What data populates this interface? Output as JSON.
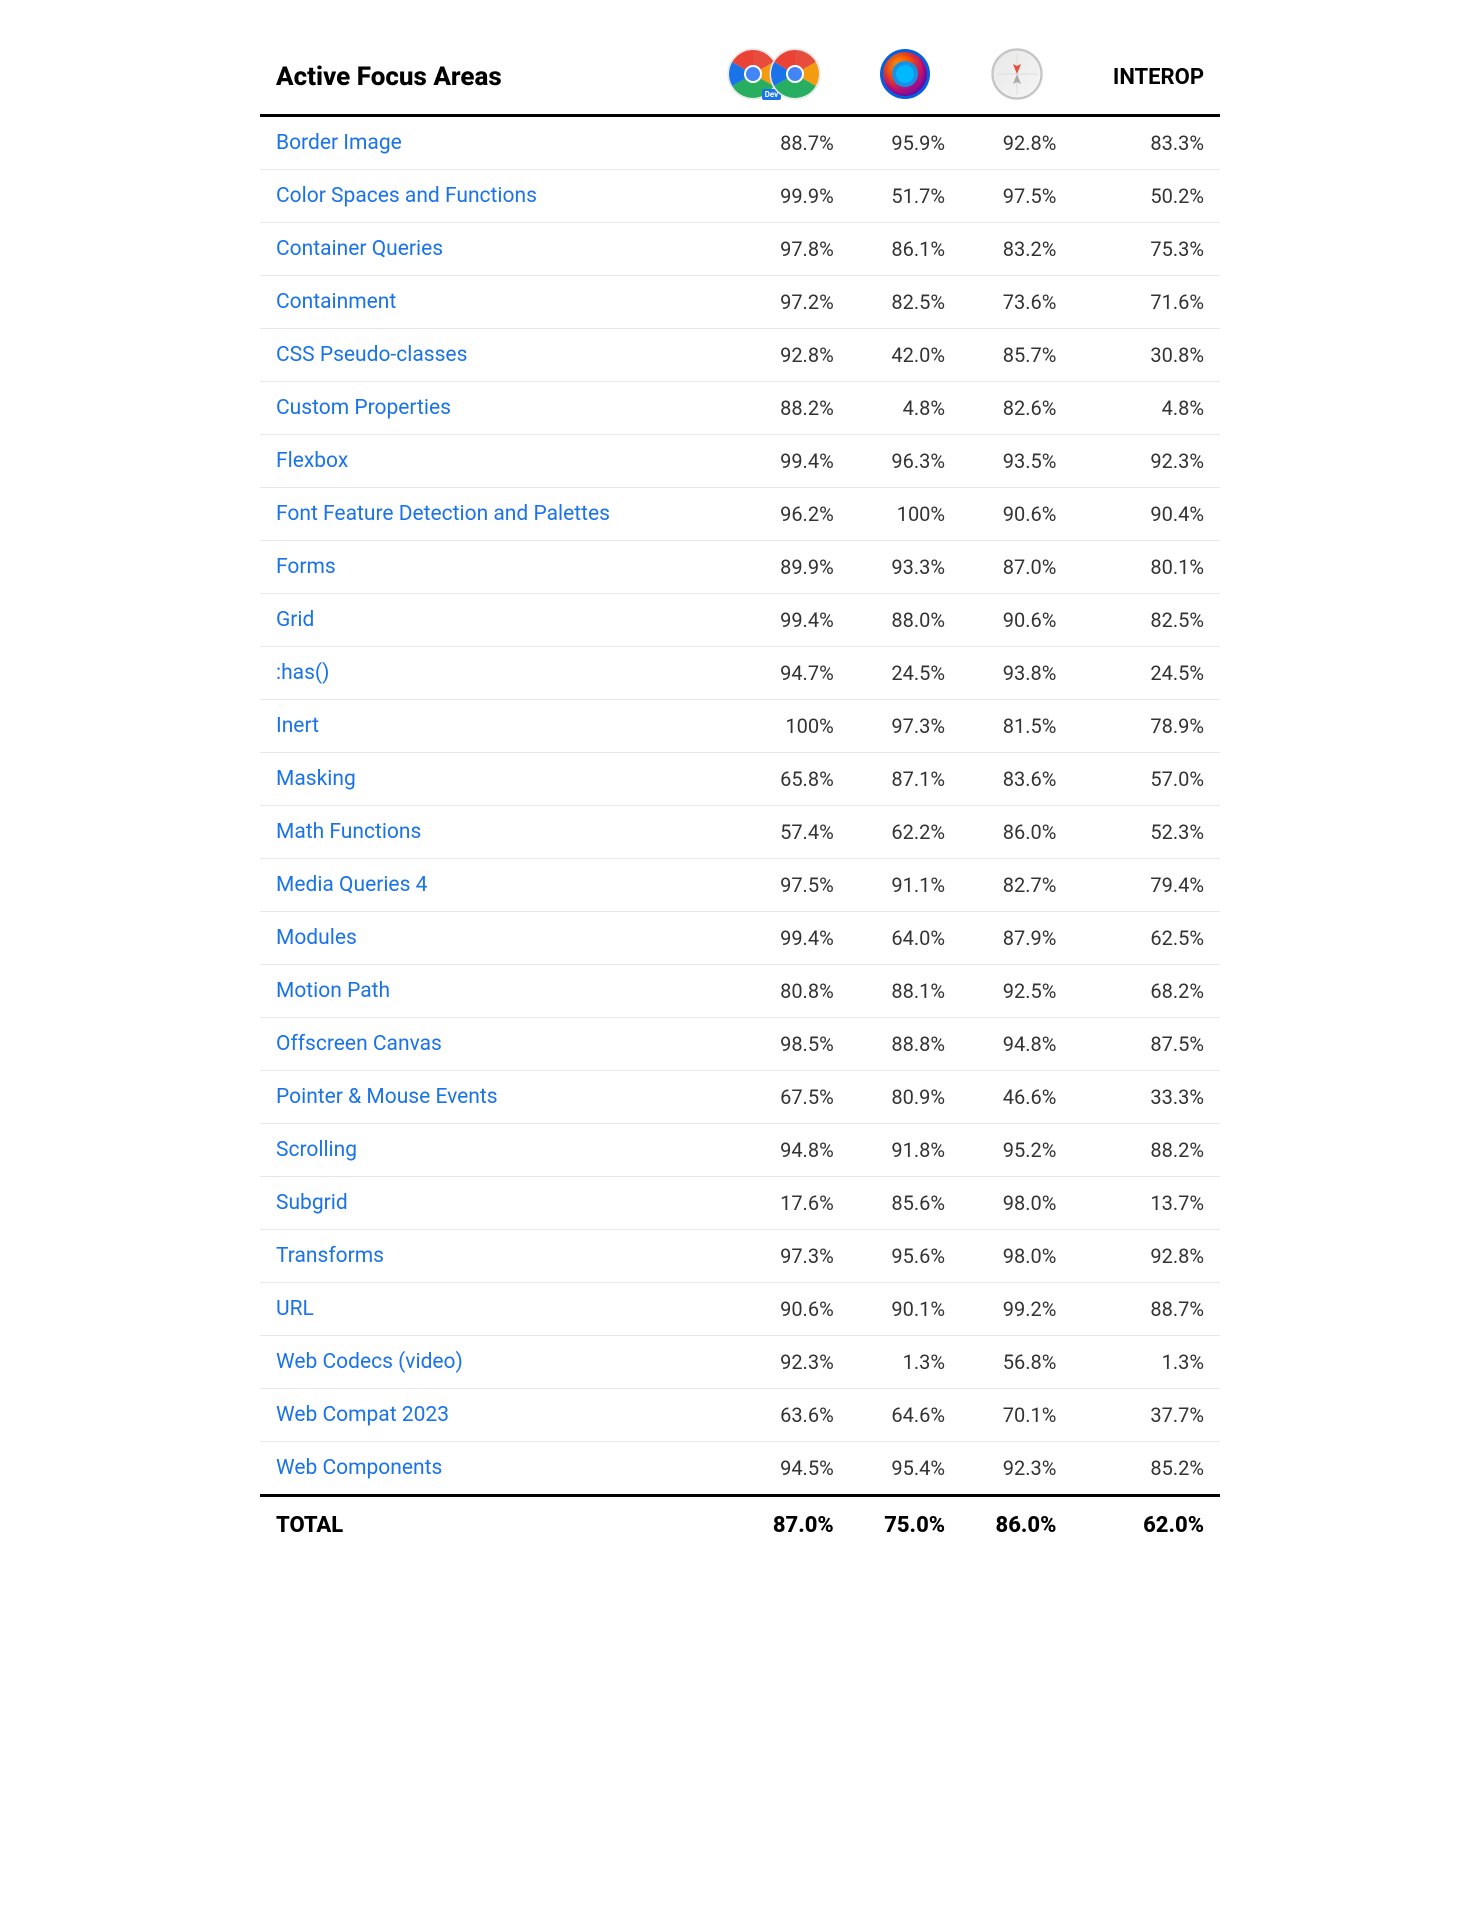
{
  "header": {
    "col_name": "Active Focus Areas",
    "col_interop": "INTEROP"
  },
  "columns": [
    {
      "id": "chrome_dev",
      "type": "chrome_dev"
    },
    {
      "id": "firefox",
      "type": "firefox"
    },
    {
      "id": "safari",
      "type": "safari"
    }
  ],
  "rows": [
    {
      "name": "Border Image",
      "chrome": "88.7%",
      "firefox": "95.9%",
      "safari": "92.8%",
      "interop": "83.3%"
    },
    {
      "name": "Color Spaces and Functions",
      "chrome": "99.9%",
      "firefox": "51.7%",
      "safari": "97.5%",
      "interop": "50.2%"
    },
    {
      "name": "Container Queries",
      "chrome": "97.8%",
      "firefox": "86.1%",
      "safari": "83.2%",
      "interop": "75.3%"
    },
    {
      "name": "Containment",
      "chrome": "97.2%",
      "firefox": "82.5%",
      "safari": "73.6%",
      "interop": "71.6%"
    },
    {
      "name": "CSS Pseudo-classes",
      "chrome": "92.8%",
      "firefox": "42.0%",
      "safari": "85.7%",
      "interop": "30.8%"
    },
    {
      "name": "Custom Properties",
      "chrome": "88.2%",
      "firefox": "4.8%",
      "safari": "82.6%",
      "interop": "4.8%"
    },
    {
      "name": "Flexbox",
      "chrome": "99.4%",
      "firefox": "96.3%",
      "safari": "93.5%",
      "interop": "92.3%"
    },
    {
      "name": "Font Feature Detection and Palettes",
      "chrome": "96.2%",
      "firefox": "100%",
      "safari": "90.6%",
      "interop": "90.4%"
    },
    {
      "name": "Forms",
      "chrome": "89.9%",
      "firefox": "93.3%",
      "safari": "87.0%",
      "interop": "80.1%"
    },
    {
      "name": "Grid",
      "chrome": "99.4%",
      "firefox": "88.0%",
      "safari": "90.6%",
      "interop": "82.5%"
    },
    {
      "name": ":has()",
      "chrome": "94.7%",
      "firefox": "24.5%",
      "safari": "93.8%",
      "interop": "24.5%"
    },
    {
      "name": "Inert",
      "chrome": "100%",
      "firefox": "97.3%",
      "safari": "81.5%",
      "interop": "78.9%"
    },
    {
      "name": "Masking",
      "chrome": "65.8%",
      "firefox": "87.1%",
      "safari": "83.6%",
      "interop": "57.0%"
    },
    {
      "name": "Math Functions",
      "chrome": "57.4%",
      "firefox": "62.2%",
      "safari": "86.0%",
      "interop": "52.3%"
    },
    {
      "name": "Media Queries 4",
      "chrome": "97.5%",
      "firefox": "91.1%",
      "safari": "82.7%",
      "interop": "79.4%"
    },
    {
      "name": "Modules",
      "chrome": "99.4%",
      "firefox": "64.0%",
      "safari": "87.9%",
      "interop": "62.5%"
    },
    {
      "name": "Motion Path",
      "chrome": "80.8%",
      "firefox": "88.1%",
      "safari": "92.5%",
      "interop": "68.2%"
    },
    {
      "name": "Offscreen Canvas",
      "chrome": "98.5%",
      "firefox": "88.8%",
      "safari": "94.8%",
      "interop": "87.5%"
    },
    {
      "name": "Pointer & Mouse Events",
      "chrome": "67.5%",
      "firefox": "80.9%",
      "safari": "46.6%",
      "interop": "33.3%"
    },
    {
      "name": "Scrolling",
      "chrome": "94.8%",
      "firefox": "91.8%",
      "safari": "95.2%",
      "interop": "88.2%"
    },
    {
      "name": "Subgrid",
      "chrome": "17.6%",
      "firefox": "85.6%",
      "safari": "98.0%",
      "interop": "13.7%"
    },
    {
      "name": "Transforms",
      "chrome": "97.3%",
      "firefox": "95.6%",
      "safari": "98.0%",
      "interop": "92.8%"
    },
    {
      "name": "URL",
      "chrome": "90.6%",
      "firefox": "90.1%",
      "safari": "99.2%",
      "interop": "88.7%"
    },
    {
      "name": "Web Codecs (video)",
      "chrome": "92.3%",
      "firefox": "1.3%",
      "safari": "56.8%",
      "interop": "1.3%"
    },
    {
      "name": "Web Compat 2023",
      "chrome": "63.6%",
      "firefox": "64.6%",
      "safari": "70.1%",
      "interop": "37.7%"
    },
    {
      "name": "Web Components",
      "chrome": "94.5%",
      "firefox": "95.4%",
      "safari": "92.3%",
      "interop": "85.2%"
    }
  ],
  "footer": {
    "label": "TOTAL",
    "chrome": "87.0%",
    "firefox": "75.0%",
    "safari": "86.0%",
    "interop": "62.0%"
  }
}
